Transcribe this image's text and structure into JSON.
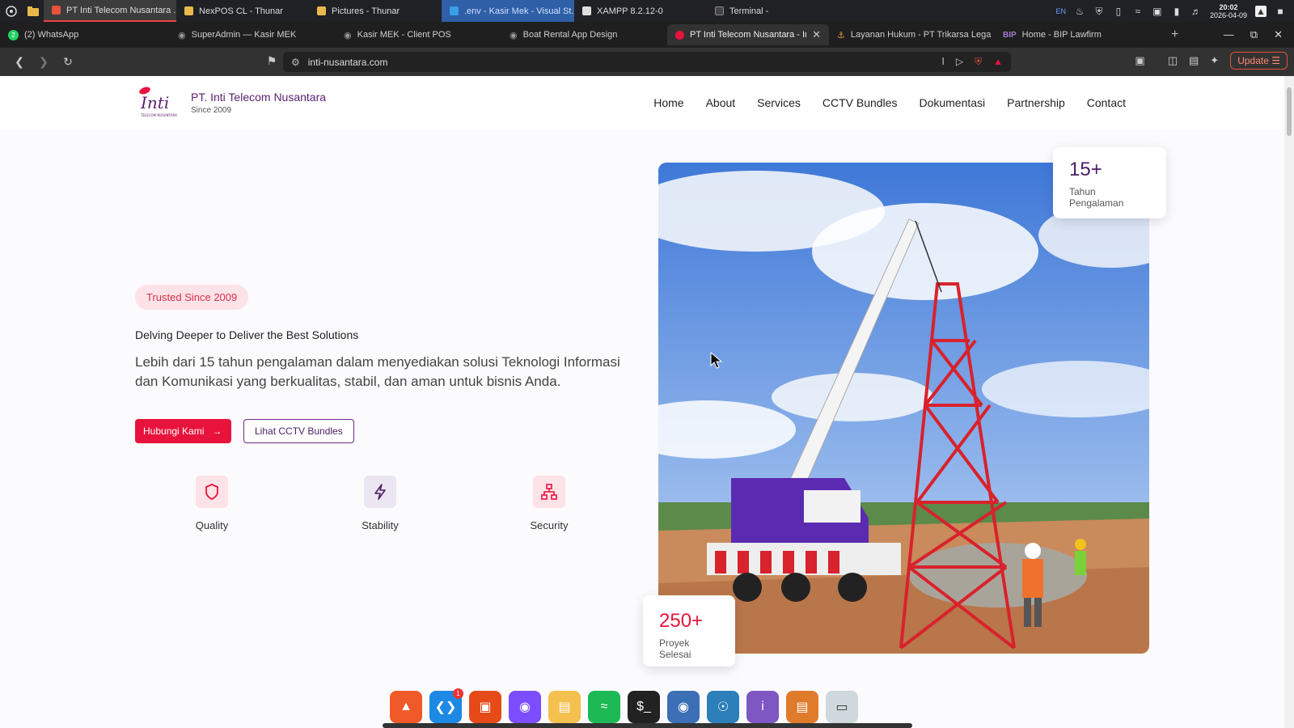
{
  "system": {
    "tasks": [
      {
        "label": "PT Inti Telecom Nusantara ...",
        "color": "#e8513a"
      },
      {
        "label": "NexPOS CL - Thunar",
        "color": "#e8b84a"
      },
      {
        "label": "Pictures - Thunar",
        "color": "#e8b84a"
      },
      {
        "label": ".env - Kasir Mek - Visual St...",
        "color": "#3aa0e8"
      },
      {
        "label": "XAMPP 8.2.12-0",
        "color": "#dddddd"
      },
      {
        "label": "Terminal -",
        "color": "#444444"
      }
    ],
    "lang": "EN",
    "time": "20:02",
    "date": "2026-04-09"
  },
  "browser": {
    "tabs": [
      {
        "label": "(2) WhatsApp"
      },
      {
        "label": "SuperAdmin — Kasir MEK"
      },
      {
        "label": "Kasir MEK - Client POS"
      },
      {
        "label": "Boat Rental App Design"
      },
      {
        "label": "PT Inti Telecom Nusantara - In"
      },
      {
        "label": "Layanan Hukum - PT Trikarsa Lega"
      },
      {
        "label": "Home - BIP Lawfirm"
      }
    ],
    "whatsapp_badge": "2",
    "url": "inti-nusantara.com",
    "update_label": "Update"
  },
  "site": {
    "brand_name": "PT. Inti Telecom Nusantara",
    "brand_since": "Since 2009",
    "logo_text": "Inti",
    "logo_sub": "TELECOM NUSANTARA",
    "nav": [
      "Home",
      "About",
      "Services",
      "CCTV Bundles",
      "Dokumentasi",
      "Partnership",
      "Contact"
    ],
    "badge": "Trusted Since 2009",
    "tagline": "Delving Deeper to Deliver the Best Solutions",
    "description": "Lebih dari 15 tahun pengalaman dalam menyediakan solusi Teknologi Informasi dan Komunikasi yang berkualitas, stabil, dan aman untuk bisnis Anda.",
    "cta_primary": "Hubungi Kami",
    "cta_secondary": "Lihat CCTV Bundles",
    "features": [
      {
        "label": "Quality",
        "icon": "shield-icon",
        "bg": "#fde2e7",
        "color": "#e8133c"
      },
      {
        "label": "Stability",
        "icon": "bolt-icon",
        "bg": "#ece6f3",
        "color": "#4a1e66"
      },
      {
        "label": "Security",
        "icon": "network-icon",
        "bg": "#fde2e7",
        "color": "#e8133c"
      }
    ],
    "stat_top": {
      "value": "15+",
      "label": "Tahun Pengalaman"
    },
    "stat_bottom": {
      "value": "250+",
      "label": "Proyek Selesai"
    },
    "colors": {
      "accent": "#e8133c",
      "brand": "#4a1e66"
    }
  },
  "dock": {
    "apps": [
      "brave",
      "vscode",
      "office",
      "github-desktop",
      "files",
      "spotify",
      "terminal",
      "screenshot",
      "web-browser",
      "info",
      "document-viewer",
      "window"
    ],
    "vscode_badge": "1"
  }
}
